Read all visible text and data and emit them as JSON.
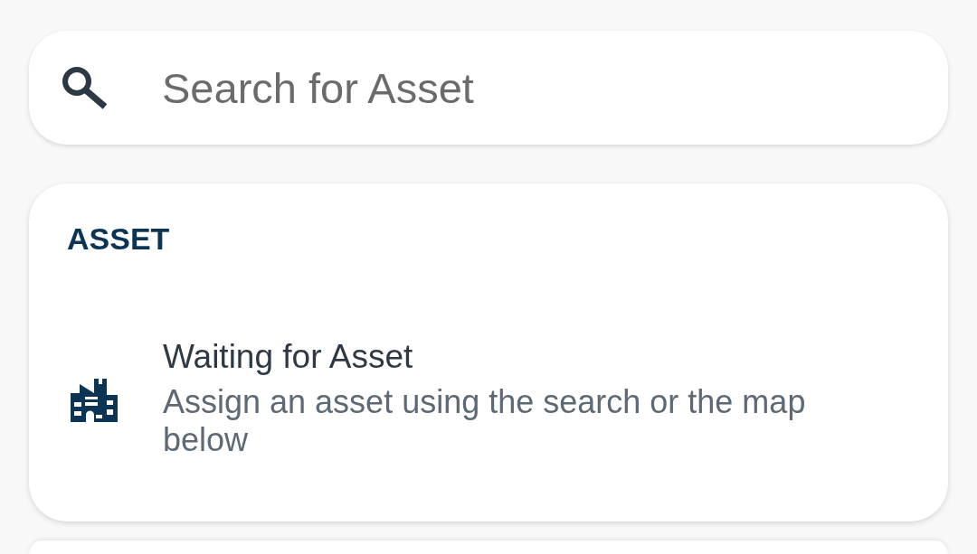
{
  "search": {
    "placeholder": "Search for Asset"
  },
  "asset_card": {
    "heading": "ASSET",
    "item": {
      "title": "Waiting for Asset",
      "subtitle": "Assign an asset using the search or the map below"
    }
  }
}
